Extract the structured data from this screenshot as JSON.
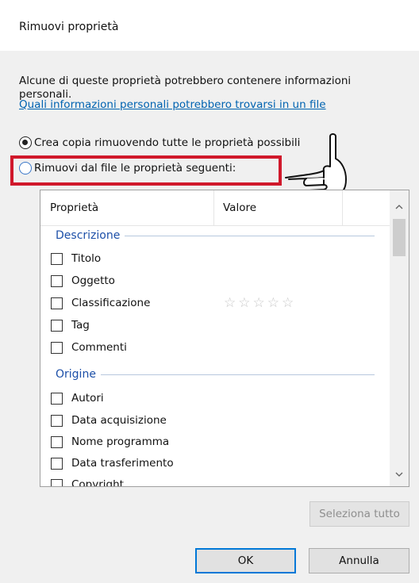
{
  "dialog": {
    "title": "Rimuovi proprietà",
    "description": "Alcune di queste proprietà potrebbero contenere informazioni personali.",
    "link_text": "Quali informazioni personali potrebbero trovarsi in un file"
  },
  "options": {
    "create_copy": {
      "label": "Crea copia rimuovendo tutte le proprietà possibili",
      "selected": true
    },
    "remove_from_file": {
      "label": "Rimuovi dal file le proprietà seguenti:",
      "selected": false
    }
  },
  "annotation": {
    "highlight_color": "#d0182b",
    "pointer_icon": "pointing-hand-icon"
  },
  "table": {
    "columns": [
      "Proprietà",
      "Valore"
    ],
    "groups": [
      {
        "label": "Descrizione",
        "items": [
          {
            "label": "Titolo",
            "checked": false
          },
          {
            "label": "Oggetto",
            "checked": false
          },
          {
            "label": "Classificazione",
            "checked": false,
            "value_stars": 5,
            "rating": 0
          },
          {
            "label": "Tag",
            "checked": false
          },
          {
            "label": "Commenti",
            "checked": false
          }
        ]
      },
      {
        "label": "Origine",
        "items": [
          {
            "label": "Autori",
            "checked": false
          },
          {
            "label": "Data acquisizione",
            "checked": false
          },
          {
            "label": "Nome programma",
            "checked": false
          },
          {
            "label": "Data trasferimento",
            "checked": false
          },
          {
            "label": "Copyright",
            "checked": false
          }
        ]
      }
    ],
    "rating_stars": "☆☆☆☆☆",
    "scroll_up_icon": "chevron-up-icon",
    "scroll_down_icon": "chevron-down-icon"
  },
  "buttons": {
    "select_all": "Seleziona tutto",
    "ok": "OK",
    "cancel": "Annulla"
  },
  "colors": {
    "link": "#0063b1",
    "group_header": "#1c4fa8",
    "ok_focus_border": "#0078d7",
    "dialog_background": "#f0f0f0"
  }
}
